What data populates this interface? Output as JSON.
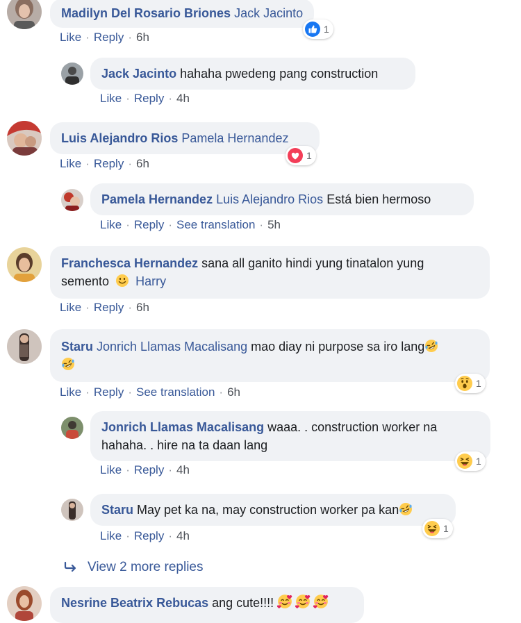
{
  "icons": {
    "like": "like-icon",
    "love": "love-icon",
    "wow": "wow-icon",
    "haha": "haha-icon",
    "smile": "smile-icon",
    "rofl": "rofl-emoji",
    "hearts": "smiling-hearts-emoji"
  },
  "colors": {
    "link": "#385898",
    "bubble": "#f0f2f5",
    "meta": "#4b4f56",
    "like_blue": "#1877f2",
    "love_red": "#f33e58",
    "emoji_yellow": "#ffcc4d"
  },
  "actions": {
    "like": "Like",
    "reply": "Reply",
    "sep": "·",
    "see_translation": "See translation"
  },
  "comments": [
    {
      "author": "Madilyn Del Rosario Briones",
      "tag": "Jack Jacinto",
      "text": "",
      "time": "6h",
      "reaction_count": "1"
    },
    {
      "author": "Jack Jacinto",
      "tag": "",
      "text": "hahaha pwedeng pang construction",
      "time": "4h"
    },
    {
      "author": "Luis Alejandro Rios",
      "tag": "Pamela Hernandez",
      "text": "",
      "time": "6h",
      "reaction_count": "1"
    },
    {
      "author": "Pamela Hernandez",
      "tag": "Luis Alejandro Rios",
      "text": "Está bien hermoso",
      "time": "5h"
    },
    {
      "author": "Franchesca Hernandez",
      "text1": "sana all ganito hindi yung tinatalon yung",
      "text2": "semento",
      "tag2": "Harry",
      "time": "6h"
    },
    {
      "author": "Staru",
      "tag": "Jonrich Llamas Macalisang",
      "text": "mao diay ni purpose sa iro lang",
      "time": "6h",
      "reaction_count": "1"
    },
    {
      "author": "Jonrich Llamas Macalisang",
      "text1": "waaa. . construction worker na",
      "text2": "hahaha. . hire na ta daan lang",
      "time": "4h",
      "reaction_count": "1"
    },
    {
      "author": "Staru",
      "text": "May pet ka na, may construction worker pa kan",
      "time": "4h",
      "reaction_count": "1"
    },
    {
      "author": "Nesrine Beatrix Rebucas",
      "text": "ang cute!!!!"
    }
  ],
  "view_more": "View 2 more replies"
}
